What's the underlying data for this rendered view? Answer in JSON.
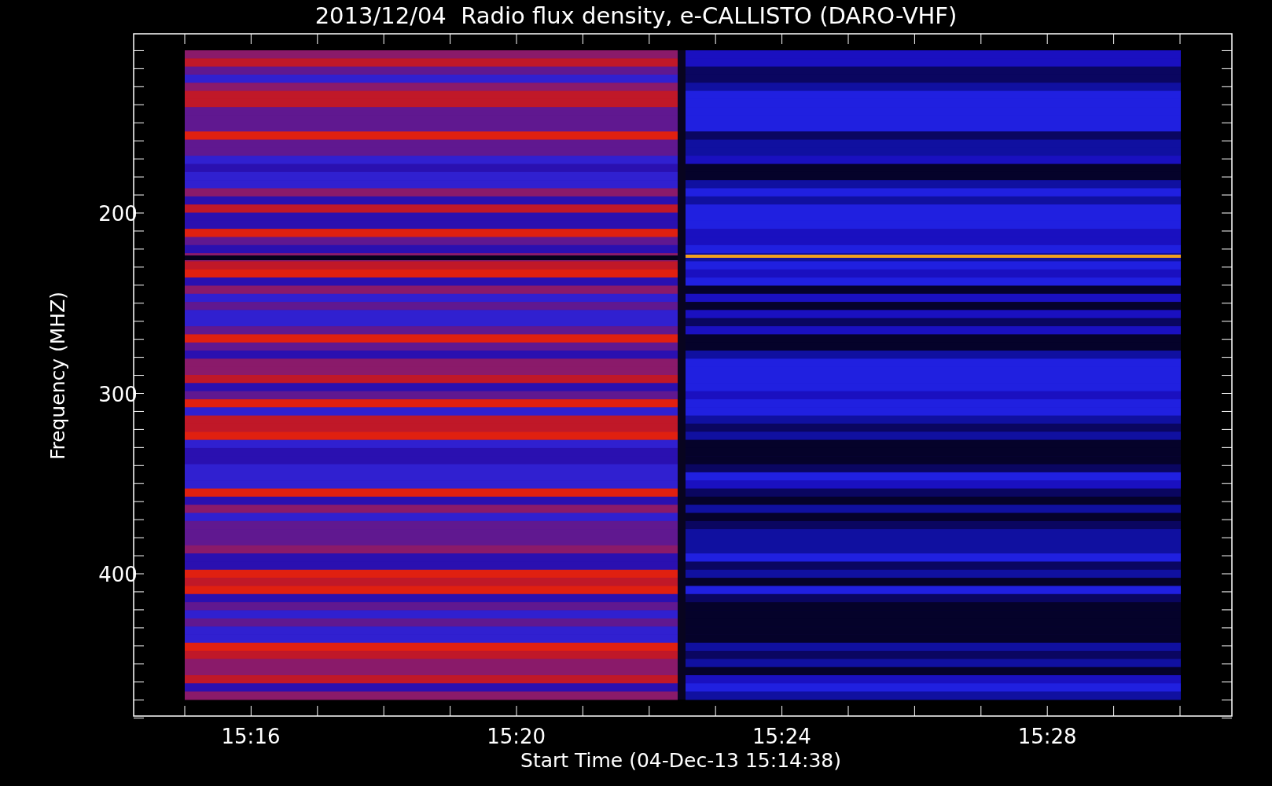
{
  "title": "2013/12/04  Radio flux density, e-CALLISTO (DARO-VHF)",
  "y_axis": {
    "label": "Frequency (MHZ)",
    "ticks": [
      "200",
      "300",
      "400"
    ]
  },
  "x_axis": {
    "label": "Start Time (04-Dec-13 15:14:38)",
    "ticks": [
      "15:16",
      "15:20",
      "15:24",
      "15:28"
    ]
  }
}
